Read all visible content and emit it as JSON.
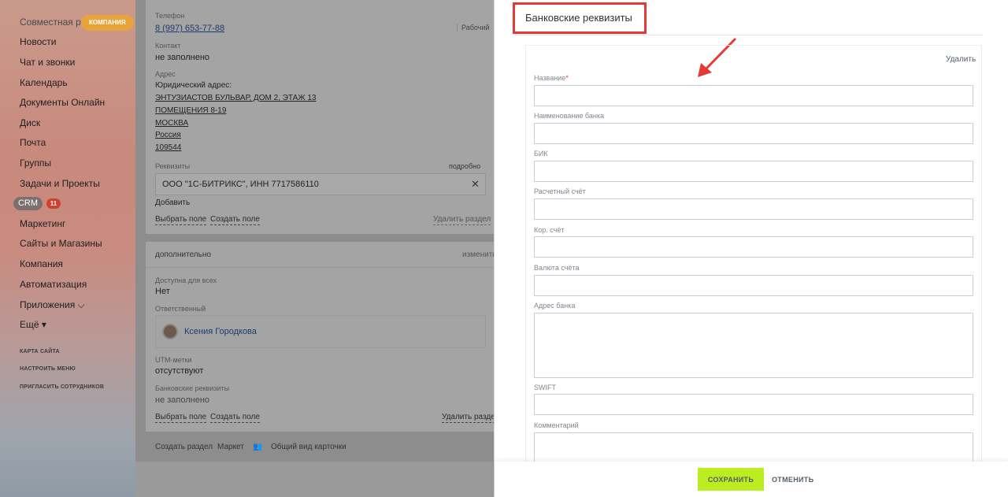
{
  "sidebar": {
    "items": [
      {
        "label": "Совместная ра"
      },
      {
        "label": "Новости"
      },
      {
        "label": "Чат и звонки"
      },
      {
        "label": "Календарь"
      },
      {
        "label": "Документы Онлайн"
      },
      {
        "label": "Диск"
      },
      {
        "label": "Почта"
      },
      {
        "label": "Группы"
      },
      {
        "label": "Задачи и Проекты"
      },
      {
        "label": "Маркетинг"
      },
      {
        "label": "Сайты и Магазины"
      },
      {
        "label": "Компания"
      },
      {
        "label": "Автоматизация"
      },
      {
        "label": "Приложения ⌵"
      },
      {
        "label": "Ещё ▾"
      }
    ],
    "company_badge": "КОМПАНИЯ",
    "crm_label": "CRM",
    "crm_count": "11",
    "footer_links": [
      "КАРТА САЙТА",
      "НАСТРОИТЬ МЕНЮ",
      "ПРИГЛАСИТЬ СОТРУДНИКОВ"
    ]
  },
  "card": {
    "phone_label": "Телефон",
    "phone_value": "8 (997) 653-77-88",
    "phone_type": "Рабочий",
    "contact_label": "Контакт",
    "contact_value": "не заполнено",
    "address_label": "Адрес",
    "legal_address_label": "Юридический адрес:",
    "address_lines": [
      "ЭНТУЗИАСТОВ БУЛЬВАР, ДОМ 2, ЭТАЖ 13",
      "ПОМЕЩЕНИЯ 8-19",
      "МОСКВА",
      "Россия",
      "109544"
    ],
    "requisites_label": "Реквизиты",
    "requisites_detail": "подробно",
    "requisites_value": "ООО \"1С-БИТРИКС\", ИНН 7717586110",
    "requisites_add": "Добавить",
    "select_field": "Выбрать поле",
    "create_field": "Создать поле",
    "delete_section": "Удалить раздел"
  },
  "extra": {
    "title": "дополнительно",
    "edit": "изменить",
    "available_label": "Доступна для всех",
    "available_value": "Нет",
    "responsible_label": "Ответственный",
    "responsible_name": "Ксения Городкова",
    "utm_label": "UTM-метки",
    "utm_value": "отсутствуют",
    "bank_label": "Банковские реквизиты",
    "bank_value": "не заполнено",
    "select_field": "Выбрать поле",
    "create_field": "Создать поле",
    "delete_section": "Удалить раздел"
  },
  "bottom_links": {
    "create_section": "Создать раздел",
    "market": "Маркет",
    "general_view": "Общий вид карточки"
  },
  "panel": {
    "title": "Банковские реквизиты",
    "delete": "Удалить",
    "fields": {
      "name": "Название",
      "bank_name": "Наименование банка",
      "bik": "БИК",
      "account": "Расчетный счёт",
      "corr_account": "Кор. счёт",
      "currency": "Валюта счёта",
      "bank_address": "Адрес банка",
      "swift": "SWIFT",
      "comment": "Комментарий"
    },
    "required_mark": "*",
    "save": "СОХРАНИТЬ",
    "cancel": "ОТМЕНИТЬ"
  },
  "colors": {
    "highlight_red": "#e53935",
    "save_green": "#bbed21",
    "link_blue": "#1d3a6e"
  }
}
